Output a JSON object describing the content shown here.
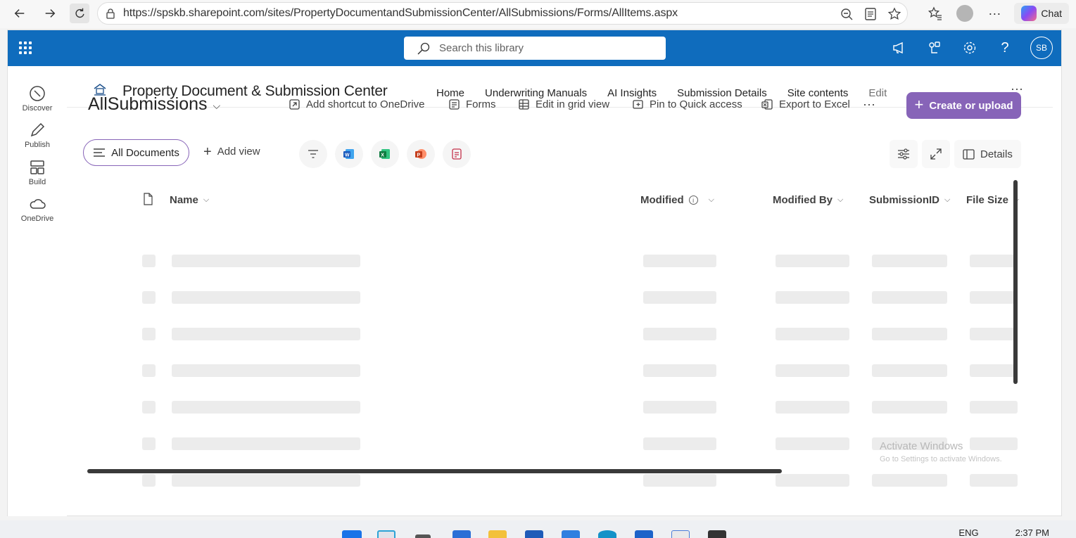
{
  "browser": {
    "url": "https://spskb.sharepoint.com/sites/PropertyDocumentandSubmissionCenter/AllSubmissions/Forms/AllItems.aspx",
    "chat_label": "Chat"
  },
  "suitebar": {
    "search_placeholder": "Search this library",
    "avatar_initials": "SB",
    "accent": "#0f6cbd"
  },
  "appbar": {
    "items": [
      {
        "label": "Discover"
      },
      {
        "label": "Publish"
      },
      {
        "label": "Build"
      },
      {
        "label": "OneDrive"
      }
    ]
  },
  "site": {
    "title": "Property Document & Submission Center",
    "nav": [
      "Home",
      "Underwriting Manuals",
      "AI Insights",
      "Submission Details",
      "Site contents",
      "Edit"
    ]
  },
  "library": {
    "title": "AllSubmissions",
    "commands": {
      "shortcut": "Add shortcut to OneDrive",
      "forms": "Forms",
      "grid": "Edit in grid view",
      "pin": "Pin to Quick access",
      "export": "Export to Excel"
    },
    "create_label": "Create or upload",
    "create_color": "#8764b8",
    "view_label": "All Documents",
    "add_view_label": "Add view",
    "details_label": "Details",
    "columns": {
      "name": "Name",
      "modified": "Modified",
      "modified_by": "Modified By",
      "submission_id": "SubmissionID",
      "file_size": "File Size"
    },
    "loading_rows": 7
  },
  "watermark": {
    "line1": "Activate Windows",
    "line2": "Go to Settings to activate Windows."
  },
  "taskbar": {
    "lang": "ENG",
    "time": "2:37 PM"
  }
}
